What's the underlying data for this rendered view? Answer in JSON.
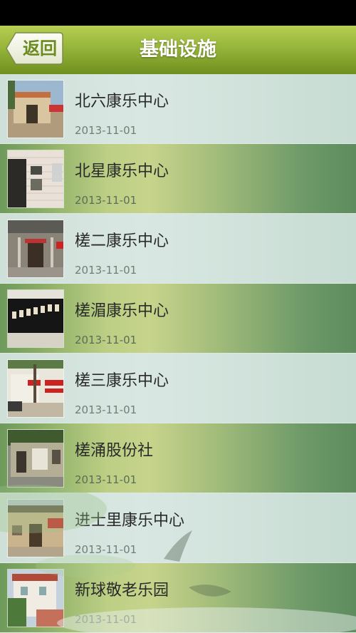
{
  "header": {
    "back_label": "返回",
    "title": "基础设施"
  },
  "items": [
    {
      "name": "北六康乐中心",
      "date": "2013-11-01"
    },
    {
      "name": "北星康乐中心",
      "date": "2013-11-01"
    },
    {
      "name": "槎二康乐中心",
      "date": "2013-11-01"
    },
    {
      "name": "槎湄康乐中心",
      "date": "2013-11-01"
    },
    {
      "name": "槎三康乐中心",
      "date": "2013-11-01"
    },
    {
      "name": "槎涌股份社",
      "date": "2013-11-01"
    },
    {
      "name": "进士里康乐中心",
      "date": "2013-11-01"
    },
    {
      "name": "新球敬老乐园",
      "date": "2013-11-01"
    }
  ],
  "colors": {
    "header_top": "#b7cf52",
    "header_bottom": "#6f8f1e",
    "row_light": "#d9e7e2",
    "row_dark": "#86aa63"
  }
}
